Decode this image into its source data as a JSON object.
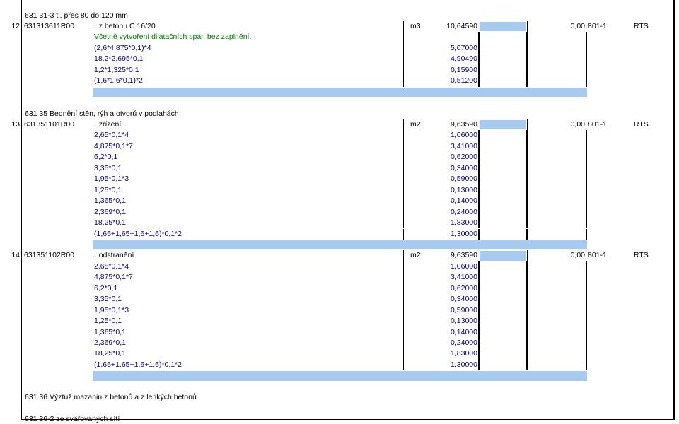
{
  "rows": [
    {
      "type": "header",
      "text": "631 31-3 tl. přes 80 do 120 mm"
    },
    {
      "type": "item",
      "no": "12",
      "code": "631313611R00",
      "desc": "...z betonu C 16/20",
      "unit": "m3",
      "qty": "10,64590",
      "price": "0,00",
      "section": "801-1",
      "src": "RTS"
    },
    {
      "type": "note",
      "text": "Včetně vytvoření dilatačních spár, bez zaplnění."
    },
    {
      "type": "calc",
      "expr": "(2,6*4,875*0,1)*4",
      "val": "5,07000"
    },
    {
      "type": "calc",
      "expr": "18,2*2,695*0,1",
      "val": "4,90490"
    },
    {
      "type": "calc",
      "expr": "1,2*1,325*0,1",
      "val": "0,15900"
    },
    {
      "type": "calc",
      "expr": "(1,6*1,6*0,1)*2",
      "val": "0,51200"
    },
    {
      "type": "bar"
    },
    {
      "type": "blank"
    },
    {
      "type": "header",
      "text": "631 35 Bednění stěn, rýh a otvorů v podlahách"
    },
    {
      "type": "item",
      "no": "13",
      "code": "631351101R00",
      "desc": "...zřízení",
      "unit": "m2",
      "qty": "9,63590",
      "price": "0,00",
      "section": "801-1",
      "src": "RTS"
    },
    {
      "type": "calc",
      "expr": "2,65*0,1*4",
      "val": "1,06000"
    },
    {
      "type": "calc",
      "expr": "4,875*0,1*7",
      "val": "3,41000"
    },
    {
      "type": "calc",
      "expr": "6,2*0,1",
      "val": "0,62000"
    },
    {
      "type": "calc",
      "expr": "3,35*0,1",
      "val": "0,34000"
    },
    {
      "type": "calc",
      "expr": "1,95*0,1*3",
      "val": "0,59000"
    },
    {
      "type": "calc",
      "expr": "1,25*0,1",
      "val": "0,13000"
    },
    {
      "type": "calc",
      "expr": "1,365*0,1",
      "val": "0,14000"
    },
    {
      "type": "calc",
      "expr": "2,369*0,1",
      "val": "0,24000"
    },
    {
      "type": "calc",
      "expr": "18,25*0,1",
      "val": "1,83000"
    },
    {
      "type": "calc",
      "expr": "(1,65+1,65+1,6+1,6)*0,1*2",
      "val": "1,30000"
    },
    {
      "type": "bar"
    },
    {
      "type": "item",
      "no": "14",
      "code": "631351102R00",
      "desc": "...odstranění",
      "unit": "m2",
      "qty": "9,63590",
      "price": "0,00",
      "section": "801-1",
      "src": "RTS"
    },
    {
      "type": "calc",
      "expr": "2,65*0,1*4",
      "val": "1,06000"
    },
    {
      "type": "calc",
      "expr": "4,875*0,1*7",
      "val": "3,41000"
    },
    {
      "type": "calc",
      "expr": "6,2*0,1",
      "val": "0,62000"
    },
    {
      "type": "calc",
      "expr": "3,35*0,1",
      "val": "0,34000"
    },
    {
      "type": "calc",
      "expr": "1,95*0,1*3",
      "val": "0,59000"
    },
    {
      "type": "calc",
      "expr": "1,25*0,1",
      "val": "0,13000"
    },
    {
      "type": "calc",
      "expr": "1,365*0,1",
      "val": "0,14000"
    },
    {
      "type": "calc",
      "expr": "2,369*0,1",
      "val": "0,24000"
    },
    {
      "type": "calc",
      "expr": "18,25*0,1",
      "val": "1,83000"
    },
    {
      "type": "calc",
      "expr": "(1,65+1,65+1,6+1,6)*0,1*2",
      "val": "1,30000"
    },
    {
      "type": "bar"
    },
    {
      "type": "blank"
    },
    {
      "type": "header",
      "text": "631 36 Výztuž mazanin z betonů a z lehkých betonů"
    },
    {
      "type": "blank"
    },
    {
      "type": "header",
      "text": "631 36-2 ze svařovaných sítí"
    }
  ]
}
